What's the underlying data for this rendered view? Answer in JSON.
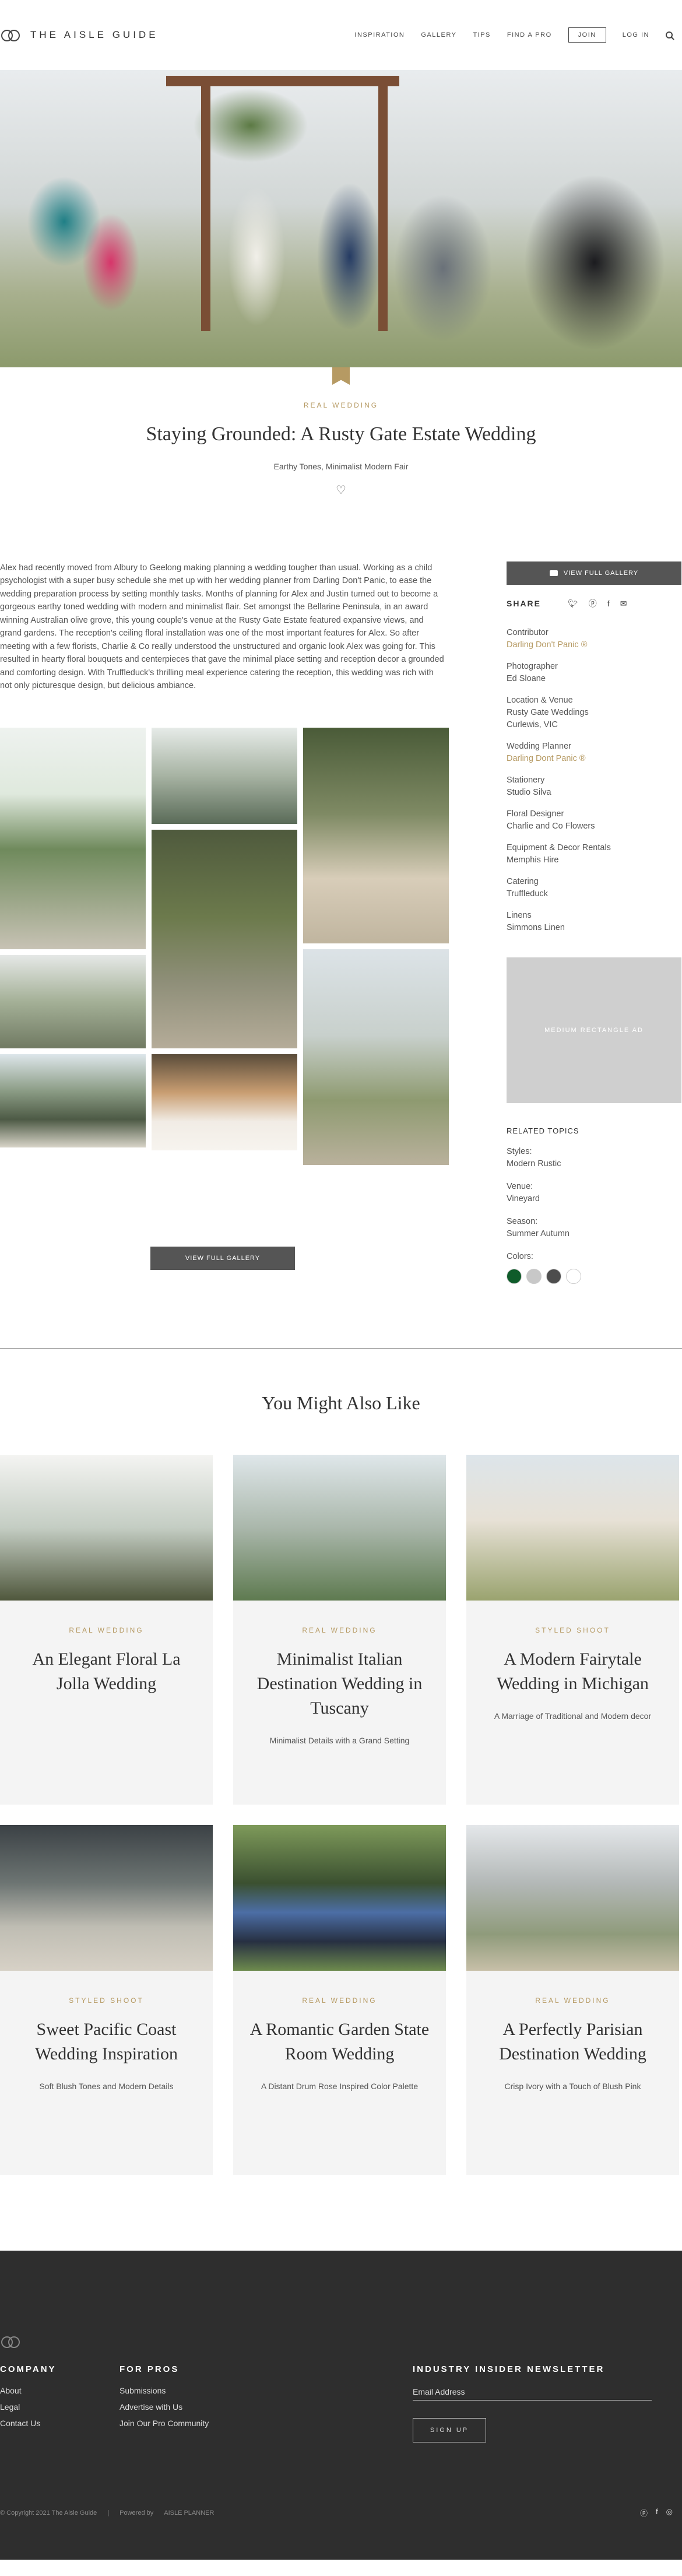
{
  "header": {
    "logo_text": "THE AISLE GUIDE",
    "nav": [
      "INSPIRATION",
      "GALLERY",
      "TIPS",
      "FIND A PRO"
    ],
    "join_label": "JOIN",
    "login_label": "LOG IN"
  },
  "article": {
    "eyebrow": "REAL WEDDING",
    "title": "Staying Grounded: A Rusty Gate Estate Wedding",
    "subtitle": "Earthy Tones, Minimalist Modern Fair",
    "heart": "♡",
    "intro": "Alex had recently moved from Albury to Geelong making planning a wedding tougher than usual. Working as a child psychologist with a super busy schedule she met up with her wedding planner from Darling Don't Panic, to ease the wedding preparation process by setting monthly tasks. Months of planning for Alex and Justin turned out to become a gorgeous earthy toned wedding with modern and minimalist flair. Set amongst the Bellarine Peninsula, in an award winning Australian olive grove, this young couple's venue at the Rusty Gate Estate featured expansive views, and grand gardens. The reception's ceiling floral installation was one of the most important features for Alex. So after meeting with a few florists, Charlie & Co really understood the unstructured and organic look Alex was going for. This resulted in hearty floral bouquets and centerpieces that gave the minimal place setting and reception decor a grounded and comforting design. With Truffleduck's thrilling meal experience catering the reception, this wedding was rich with not only picturesque design, but delicious ambiance.",
    "view_gallery_label": "VIEW FULL GALLERY"
  },
  "sidebar": {
    "view_gallery_label": "VIEW FULL GALLERY",
    "share_label": "SHARE",
    "share_icons": [
      "twitter-icon",
      "pinterest-icon",
      "facebook-icon",
      "email-icon"
    ],
    "credits": [
      {
        "role": "Contributor",
        "name": "Darling Don't Panic",
        "gold": true
      },
      {
        "role": "Photographer",
        "name": "Ed Sloane",
        "gold": false
      },
      {
        "role": "Location & Venue",
        "name": "Rusty Gate Weddings",
        "extra": "Curlewis, VIC",
        "gold": false
      },
      {
        "role": "Wedding Planner",
        "name": "Darling Dont Panic",
        "gold": true
      },
      {
        "role": "Stationery",
        "name": "Studio Silva",
        "gold": false
      },
      {
        "role": "Floral Designer",
        "name": "Charlie and Co Flowers",
        "gold": false
      },
      {
        "role": "Equipment & Decor Rentals",
        "name": "Memphis Hire",
        "gold": false
      },
      {
        "role": "Catering",
        "name": "Truffleduck",
        "gold": false
      },
      {
        "role": "Linens",
        "name": "Simmons Linen",
        "gold": false
      }
    ],
    "ad_label": "MEDIUM RECTANGLE AD",
    "related_title": "RELATED TOPICS",
    "topics": [
      {
        "label": "Styles:",
        "value": "Modern Rustic"
      },
      {
        "label": "Venue:",
        "value": "Vineyard"
      },
      {
        "label": "Season:",
        "value": "Summer Autumn"
      }
    ],
    "colors_label": "Colors:",
    "colors": [
      "#0f5c2a",
      "#c8c8c8",
      "#4d4d4d",
      "#ffffff"
    ]
  },
  "related": {
    "title": "You Might Also Like",
    "cards": [
      {
        "eyebrow": "REAL WEDDING",
        "title": "An Elegant Floral La Jolla Wedding",
        "desc": ""
      },
      {
        "eyebrow": "REAL WEDDING",
        "title": "Minimalist Italian Destination Wedding in Tuscany",
        "desc": "Minimalist Details with a Grand Setting"
      },
      {
        "eyebrow": "STYLED SHOOT",
        "title": "A Modern Fairytale Wedding in Michigan",
        "desc": "A Marriage of Traditional and Modern decor"
      },
      {
        "eyebrow": "STYLED SHOOT",
        "title": "Sweet Pacific Coast Wedding Inspiration",
        "desc": "Soft Blush Tones and Modern Details"
      },
      {
        "eyebrow": "REAL WEDDING",
        "title": "A Romantic Garden State Room Wedding",
        "desc": "A Distant Drum Rose Inspired Color Palette"
      },
      {
        "eyebrow": "REAL WEDDING",
        "title": "A Perfectly Parisian Destination Wedding",
        "desc": "Crisp Ivory with a Touch of Blush Pink"
      }
    ]
  },
  "footer": {
    "company_title": "COMPANY",
    "company_links": [
      "About",
      "Legal",
      "Contact Us"
    ],
    "pros_title": "FOR PROS",
    "pros_links": [
      "Submissions",
      "Advertise with Us",
      "Join Our Pro Community"
    ],
    "newsletter_title": "INDUSTRY INSIDER NEWSLETTER",
    "email_placeholder": "Email Address",
    "signup_label": "SIGN UP",
    "copyright": "© Copyright 2021 The Aisle Guide",
    "powered_by": "Powered by",
    "powered_brand": "AISLE PLANNER",
    "social": [
      "pinterest-icon",
      "facebook-icon",
      "instagram-icon"
    ]
  }
}
